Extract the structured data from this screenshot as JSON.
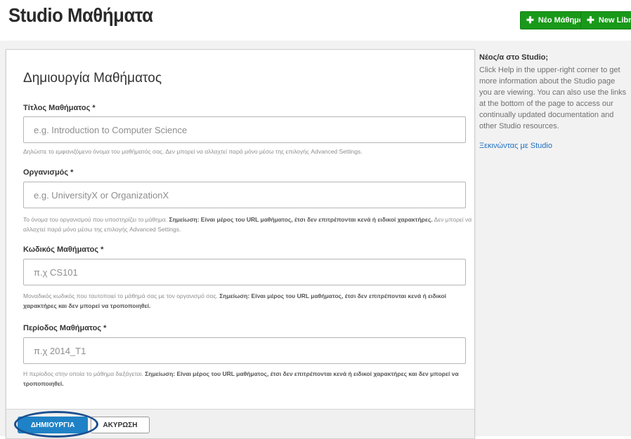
{
  "header": {
    "title": "Studio Μαθήματα",
    "new_course_button": "Νέο Μάθημα",
    "new_library_button": "New Library"
  },
  "form": {
    "title": "Δημιουργία Μαθήματος",
    "fields": [
      {
        "label": "Τίτλος Μαθήματος *",
        "placeholder": "e.g. Introduction to Computer Science",
        "value": "",
        "help_normal": "Δηλώστε το εμφανιζόμενο όνομα του μαθήματός σας. Δεν μπορεί να αλλαχτεί παρά μόνο μέσω της επιλογής Advanced Settings.",
        "help_bold": "",
        "help_after": ""
      },
      {
        "label": "Οργανισμός *",
        "placeholder": "e.g. UniversityX or OrganizationX",
        "value": "",
        "help_normal": "Το όνομα του οργανισμού που υποστηρίζει το μάθημα. ",
        "help_bold": "Σημείωση: Είναι μέρος του URL μαθήματος, έτσι δεν επιτρέπονται κενά ή ειδικοί χαρακτήρες.",
        "help_after": " Δεν μπορεί να αλλαχτεί παρά μόνο μέσω της επιλογής Advanced Settings."
      },
      {
        "label": "Κωδικός Μαθήματος *",
        "placeholder": "π.χ CS101",
        "value": "",
        "help_normal": "Μοναδικός κωδικός που ταυτοποιεί το μάθημά σας με τον οργανισμό σας. ",
        "help_bold": "Σημείωση: Είναι μέρος του URL μαθήματος, έτσι δεν επιτρέπονται κενά ή ειδικοί χαρακτήρες και δεν μπορεί να τροποποιηθεί.",
        "help_after": ""
      },
      {
        "label": "Περίοδος Μαθήματος *",
        "placeholder": "π.χ 2014_T1",
        "value": "",
        "help_normal": "Η περίοδος στην οποία το μάθημα διεξάγεται. ",
        "help_bold": "Σημείωση: Είναι μέρος του URL μαθήματος, έτσι δεν επιτρέπονται κενά ή ειδικοί χαρακτήρες και δεν μπορεί να τροποποιηθεί.",
        "help_after": ""
      }
    ],
    "create_button": "ΔΗΜΙΟΥΡΓΙΑ",
    "cancel_button": "ΑΚΥΡΩΣΗ"
  },
  "sidebar": {
    "title": "Νέος/α στο Studio;",
    "text": "Click Help in the upper-right corner to get more information about the Studio page you are viewing. You can also use the links at the bottom of the page to access our continually updated documentation and other Studio resources.",
    "link": "Ξεκινώντας με Studio"
  },
  "colors": {
    "header_button": "#199919",
    "primary_button": "#1f82c6",
    "highlight_ring": "#1c4f8e",
    "link": "#1f6fc0"
  },
  "icons": {
    "plus": "plus-icon"
  }
}
